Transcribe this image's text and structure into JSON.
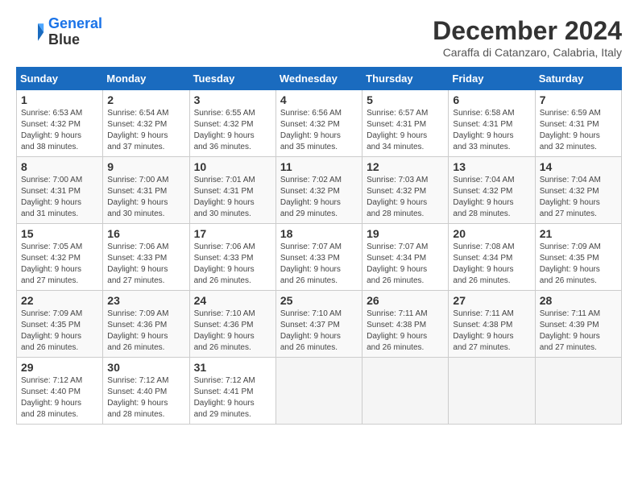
{
  "logo": {
    "line1": "General",
    "line2": "Blue"
  },
  "title": "December 2024",
  "subtitle": "Caraffa di Catanzaro, Calabria, Italy",
  "days_of_week": [
    "Sunday",
    "Monday",
    "Tuesday",
    "Wednesday",
    "Thursday",
    "Friday",
    "Saturday"
  ],
  "weeks": [
    [
      {
        "day": "1",
        "info": "Sunrise: 6:53 AM\nSunset: 4:32 PM\nDaylight: 9 hours\nand 38 minutes."
      },
      {
        "day": "2",
        "info": "Sunrise: 6:54 AM\nSunset: 4:32 PM\nDaylight: 9 hours\nand 37 minutes."
      },
      {
        "day": "3",
        "info": "Sunrise: 6:55 AM\nSunset: 4:32 PM\nDaylight: 9 hours\nand 36 minutes."
      },
      {
        "day": "4",
        "info": "Sunrise: 6:56 AM\nSunset: 4:32 PM\nDaylight: 9 hours\nand 35 minutes."
      },
      {
        "day": "5",
        "info": "Sunrise: 6:57 AM\nSunset: 4:31 PM\nDaylight: 9 hours\nand 34 minutes."
      },
      {
        "day": "6",
        "info": "Sunrise: 6:58 AM\nSunset: 4:31 PM\nDaylight: 9 hours\nand 33 minutes."
      },
      {
        "day": "7",
        "info": "Sunrise: 6:59 AM\nSunset: 4:31 PM\nDaylight: 9 hours\nand 32 minutes."
      }
    ],
    [
      {
        "day": "8",
        "info": "Sunrise: 7:00 AM\nSunset: 4:31 PM\nDaylight: 9 hours\nand 31 minutes."
      },
      {
        "day": "9",
        "info": "Sunrise: 7:00 AM\nSunset: 4:31 PM\nDaylight: 9 hours\nand 30 minutes."
      },
      {
        "day": "10",
        "info": "Sunrise: 7:01 AM\nSunset: 4:31 PM\nDaylight: 9 hours\nand 30 minutes."
      },
      {
        "day": "11",
        "info": "Sunrise: 7:02 AM\nSunset: 4:32 PM\nDaylight: 9 hours\nand 29 minutes."
      },
      {
        "day": "12",
        "info": "Sunrise: 7:03 AM\nSunset: 4:32 PM\nDaylight: 9 hours\nand 28 minutes."
      },
      {
        "day": "13",
        "info": "Sunrise: 7:04 AM\nSunset: 4:32 PM\nDaylight: 9 hours\nand 28 minutes."
      },
      {
        "day": "14",
        "info": "Sunrise: 7:04 AM\nSunset: 4:32 PM\nDaylight: 9 hours\nand 27 minutes."
      }
    ],
    [
      {
        "day": "15",
        "info": "Sunrise: 7:05 AM\nSunset: 4:32 PM\nDaylight: 9 hours\nand 27 minutes."
      },
      {
        "day": "16",
        "info": "Sunrise: 7:06 AM\nSunset: 4:33 PM\nDaylight: 9 hours\nand 27 minutes."
      },
      {
        "day": "17",
        "info": "Sunrise: 7:06 AM\nSunset: 4:33 PM\nDaylight: 9 hours\nand 26 minutes."
      },
      {
        "day": "18",
        "info": "Sunrise: 7:07 AM\nSunset: 4:33 PM\nDaylight: 9 hours\nand 26 minutes."
      },
      {
        "day": "19",
        "info": "Sunrise: 7:07 AM\nSunset: 4:34 PM\nDaylight: 9 hours\nand 26 minutes."
      },
      {
        "day": "20",
        "info": "Sunrise: 7:08 AM\nSunset: 4:34 PM\nDaylight: 9 hours\nand 26 minutes."
      },
      {
        "day": "21",
        "info": "Sunrise: 7:09 AM\nSunset: 4:35 PM\nDaylight: 9 hours\nand 26 minutes."
      }
    ],
    [
      {
        "day": "22",
        "info": "Sunrise: 7:09 AM\nSunset: 4:35 PM\nDaylight: 9 hours\nand 26 minutes."
      },
      {
        "day": "23",
        "info": "Sunrise: 7:09 AM\nSunset: 4:36 PM\nDaylight: 9 hours\nand 26 minutes."
      },
      {
        "day": "24",
        "info": "Sunrise: 7:10 AM\nSunset: 4:36 PM\nDaylight: 9 hours\nand 26 minutes."
      },
      {
        "day": "25",
        "info": "Sunrise: 7:10 AM\nSunset: 4:37 PM\nDaylight: 9 hours\nand 26 minutes."
      },
      {
        "day": "26",
        "info": "Sunrise: 7:11 AM\nSunset: 4:38 PM\nDaylight: 9 hours\nand 26 minutes."
      },
      {
        "day": "27",
        "info": "Sunrise: 7:11 AM\nSunset: 4:38 PM\nDaylight: 9 hours\nand 27 minutes."
      },
      {
        "day": "28",
        "info": "Sunrise: 7:11 AM\nSunset: 4:39 PM\nDaylight: 9 hours\nand 27 minutes."
      }
    ],
    [
      {
        "day": "29",
        "info": "Sunrise: 7:12 AM\nSunset: 4:40 PM\nDaylight: 9 hours\nand 28 minutes."
      },
      {
        "day": "30",
        "info": "Sunrise: 7:12 AM\nSunset: 4:40 PM\nDaylight: 9 hours\nand 28 minutes."
      },
      {
        "day": "31",
        "info": "Sunrise: 7:12 AM\nSunset: 4:41 PM\nDaylight: 9 hours\nand 29 minutes."
      },
      {
        "day": "",
        "info": ""
      },
      {
        "day": "",
        "info": ""
      },
      {
        "day": "",
        "info": ""
      },
      {
        "day": "",
        "info": ""
      }
    ]
  ]
}
